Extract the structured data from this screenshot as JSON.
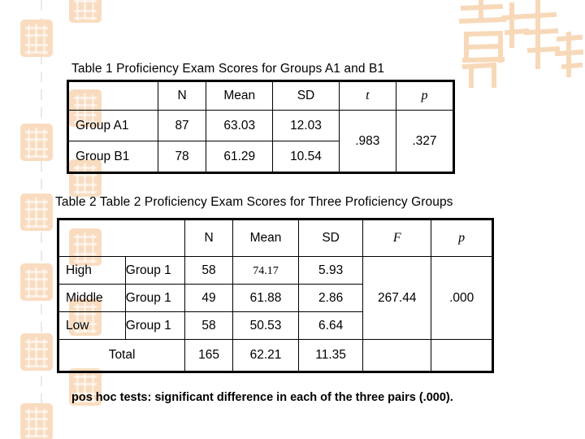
{
  "slide": {
    "background_color": "#ffffff",
    "accent_color": "#f9dcc0",
    "dash_color": "#e9e9e9",
    "seal_text": "吉祥如意"
  },
  "table1": {
    "title": "Table 1  Proficiency Exam Scores for Groups A1 and B1",
    "headers": [
      "",
      "N",
      "Mean",
      "SD",
      "t",
      "p"
    ],
    "rows": [
      {
        "label": "Group A1",
        "n": "87",
        "mean": "63.03",
        "sd": "12.03"
      },
      {
        "label": "Group B1",
        "n": "78",
        "mean": "61.29",
        "sd": "10.54"
      }
    ],
    "t_value": ".983",
    "p_value": ".327"
  },
  "table2": {
    "title": "Table 2  Table 2  Proficiency Exam Scores for Three Proficiency Groups",
    "headers": [
      "",
      "N",
      "Mean",
      "SD",
      "F",
      "p"
    ],
    "rows": [
      {
        "level": "High",
        "group": "Group 1",
        "n": "58",
        "mean": "74.17",
        "sd": "5.93"
      },
      {
        "level": "Middle",
        "group": "Group 1",
        "n": "49",
        "mean": "61.88",
        "sd": "2.86"
      },
      {
        "level": "Low",
        "group": "Group 1",
        "n": "58",
        "mean": "50.53",
        "sd": "6.64"
      }
    ],
    "total_row": {
      "label": "Total",
      "n": "165",
      "mean": "62.21",
      "sd": "11.35"
    },
    "f_value": "267.44",
    "p_value": ".000"
  },
  "footnote": {
    "text": "pos hoc tests: significant difference in each of the three pairs (.000)."
  }
}
